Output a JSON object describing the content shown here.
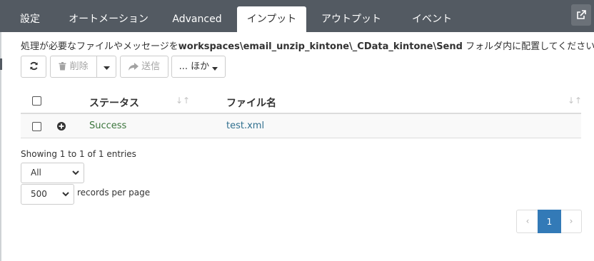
{
  "tabs": [
    {
      "label": "設定"
    },
    {
      "label": "オートメーション"
    },
    {
      "label": "Advanced"
    },
    {
      "label": "インプット",
      "active": true
    },
    {
      "label": "アウトプット"
    },
    {
      "label": "イベント"
    }
  ],
  "instruction": {
    "prefix": "処理が必要なファイルやメッセージを",
    "path": "workspaces\\email_unzip_kintone\\_CData_kintone\\Send",
    "suffix": " フォルダ内に配置してください。"
  },
  "toolbar": {
    "refresh_icon": "refresh-icon",
    "delete_label": "削除",
    "delete_icon": "trash-icon",
    "send_label": "送信",
    "send_icon": "share-arrow-icon",
    "more_label": "... ほか"
  },
  "table": {
    "columns": [
      "ステータス",
      "ファイル名"
    ],
    "rows": [
      {
        "status": "Success",
        "filename": "test.xml"
      }
    ]
  },
  "info": "Showing 1 to 1 of 1 entries",
  "filter": {
    "selected": "All"
  },
  "page_size": {
    "selected": "500",
    "label": "records per page"
  },
  "pagination": {
    "prev": "‹",
    "current": "1",
    "next": "›"
  },
  "colors": {
    "topbar": "#535a62",
    "status_success": "#3c763d",
    "link": "#31708f",
    "active_page": "#337ab7"
  }
}
